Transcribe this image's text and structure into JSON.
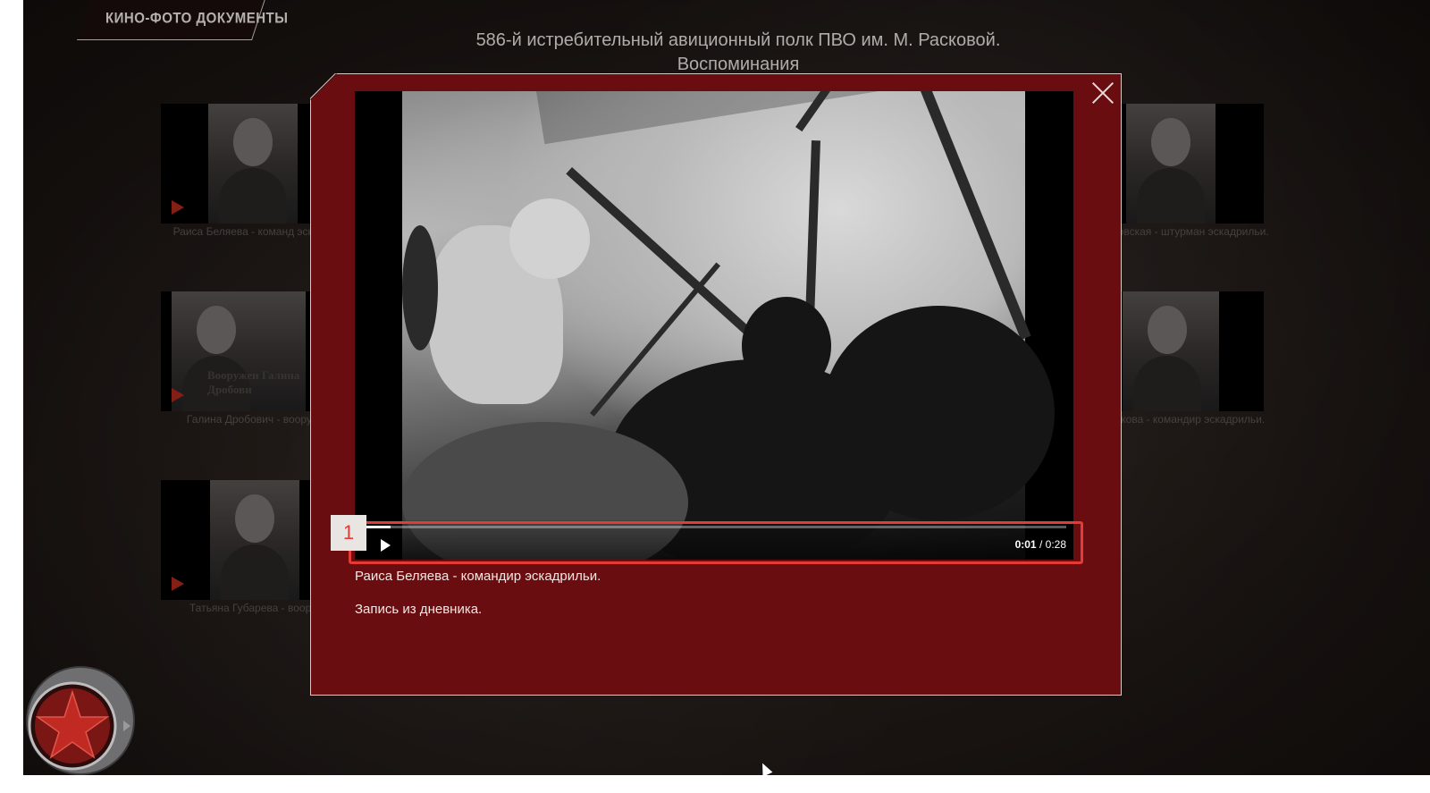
{
  "header": {
    "section_tab": "КИНО-ФОТО ДОКУМЕНТЫ",
    "title_line1": "586-й истребительный авиционный полк ПВО им. М. Расковой.",
    "title_line2": "Воспоминания"
  },
  "background_cards": {
    "left": [
      {
        "caption": "Раиса Беляева - команд эскадрильи."
      },
      {
        "caption": "Галина Дробович - вооруж",
        "photo_text": "Вооружен Галина Дробови"
      },
      {
        "caption": "Татьяна Губарева - воору"
      }
    ],
    "right": [
      {
        "caption": "а Джунковская - штурман эскадрильи."
      },
      {
        "caption": "а Ямщикова - командир эскадрильи."
      }
    ]
  },
  "modal": {
    "caption": "Раиса Беляева - командир эскадрильи.",
    "description": "Запись из дневника.",
    "close_icon": "close-icon"
  },
  "video": {
    "current_time": "0:01",
    "separator": "/",
    "duration": "0:28",
    "progress_fraction": 0.036
  },
  "annotation": {
    "marker_label": "1",
    "highlight_color": "#e33b36"
  },
  "colors": {
    "modal_background": "#6a0d10",
    "accent_red": "#b02a1e"
  }
}
